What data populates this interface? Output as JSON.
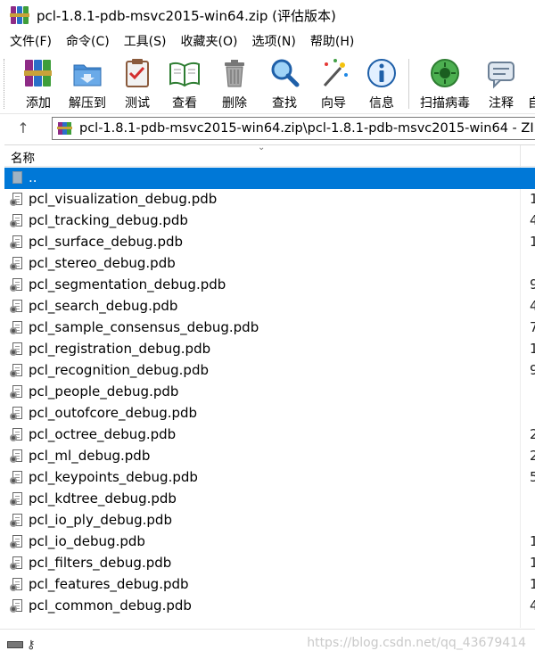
{
  "window": {
    "title": "pcl-1.8.1-pdb-msvc2015-win64.zip (评估版本)",
    "app_icon": "winrar-books-icon"
  },
  "menubar": {
    "items": [
      {
        "label": "文件(F)"
      },
      {
        "label": "命令(C)"
      },
      {
        "label": "工具(S)"
      },
      {
        "label": "收藏夹(O)"
      },
      {
        "label": "选项(N)"
      },
      {
        "label": "帮助(H)"
      }
    ]
  },
  "toolbar": {
    "buttons": [
      {
        "label": "添加",
        "icon": "add-archive-icon"
      },
      {
        "label": "解压到",
        "icon": "extract-folder-icon"
      },
      {
        "label": "测试",
        "icon": "test-clipboard-icon"
      },
      {
        "label": "查看",
        "icon": "view-book-icon"
      },
      {
        "label": "删除",
        "icon": "trash-icon"
      },
      {
        "label": "查找",
        "icon": "magnifier-icon"
      },
      {
        "label": "向导",
        "icon": "wizard-wand-icon"
      },
      {
        "label": "信息",
        "icon": "info-icon"
      },
      {
        "label": "扫描病毒",
        "icon": "virus-scan-icon"
      },
      {
        "label": "注释",
        "icon": "comment-icon"
      },
      {
        "label": "自",
        "icon": ""
      }
    ]
  },
  "address": {
    "path": "pcl-1.8.1-pdb-msvc2015-win64.zip\\pcl-1.8.1-pdb-msvc2015-win64 - ZI"
  },
  "list": {
    "column_name": "名称",
    "parent_row": "..",
    "files": [
      {
        "name": "pcl_visualization_debug.pdb",
        "size": "1"
      },
      {
        "name": "pcl_tracking_debug.pdb",
        "size": "4"
      },
      {
        "name": "pcl_surface_debug.pdb",
        "size": "1"
      },
      {
        "name": "pcl_stereo_debug.pdb",
        "size": ""
      },
      {
        "name": "pcl_segmentation_debug.pdb",
        "size": "9"
      },
      {
        "name": "pcl_search_debug.pdb",
        "size": "4"
      },
      {
        "name": "pcl_sample_consensus_debug.pdb",
        "size": "7"
      },
      {
        "name": "pcl_registration_debug.pdb",
        "size": "1"
      },
      {
        "name": "pcl_recognition_debug.pdb",
        "size": "9"
      },
      {
        "name": "pcl_people_debug.pdb",
        "size": ""
      },
      {
        "name": "pcl_outofcore_debug.pdb",
        "size": ""
      },
      {
        "name": "pcl_octree_debug.pdb",
        "size": "2"
      },
      {
        "name": "pcl_ml_debug.pdb",
        "size": "2"
      },
      {
        "name": "pcl_keypoints_debug.pdb",
        "size": "5"
      },
      {
        "name": "pcl_kdtree_debug.pdb",
        "size": ""
      },
      {
        "name": "pcl_io_ply_debug.pdb",
        "size": ""
      },
      {
        "name": "pcl_io_debug.pdb",
        "size": "1"
      },
      {
        "name": "pcl_filters_debug.pdb",
        "size": "1"
      },
      {
        "name": "pcl_features_debug.pdb",
        "size": "1"
      },
      {
        "name": "pcl_common_debug.pdb",
        "size": "4"
      }
    ]
  },
  "statusbar": {
    "watermark": "https://blog.csdn.net/qq_43679414"
  },
  "colors": {
    "selection": "#0078d7",
    "border": "#7a7a7a"
  }
}
